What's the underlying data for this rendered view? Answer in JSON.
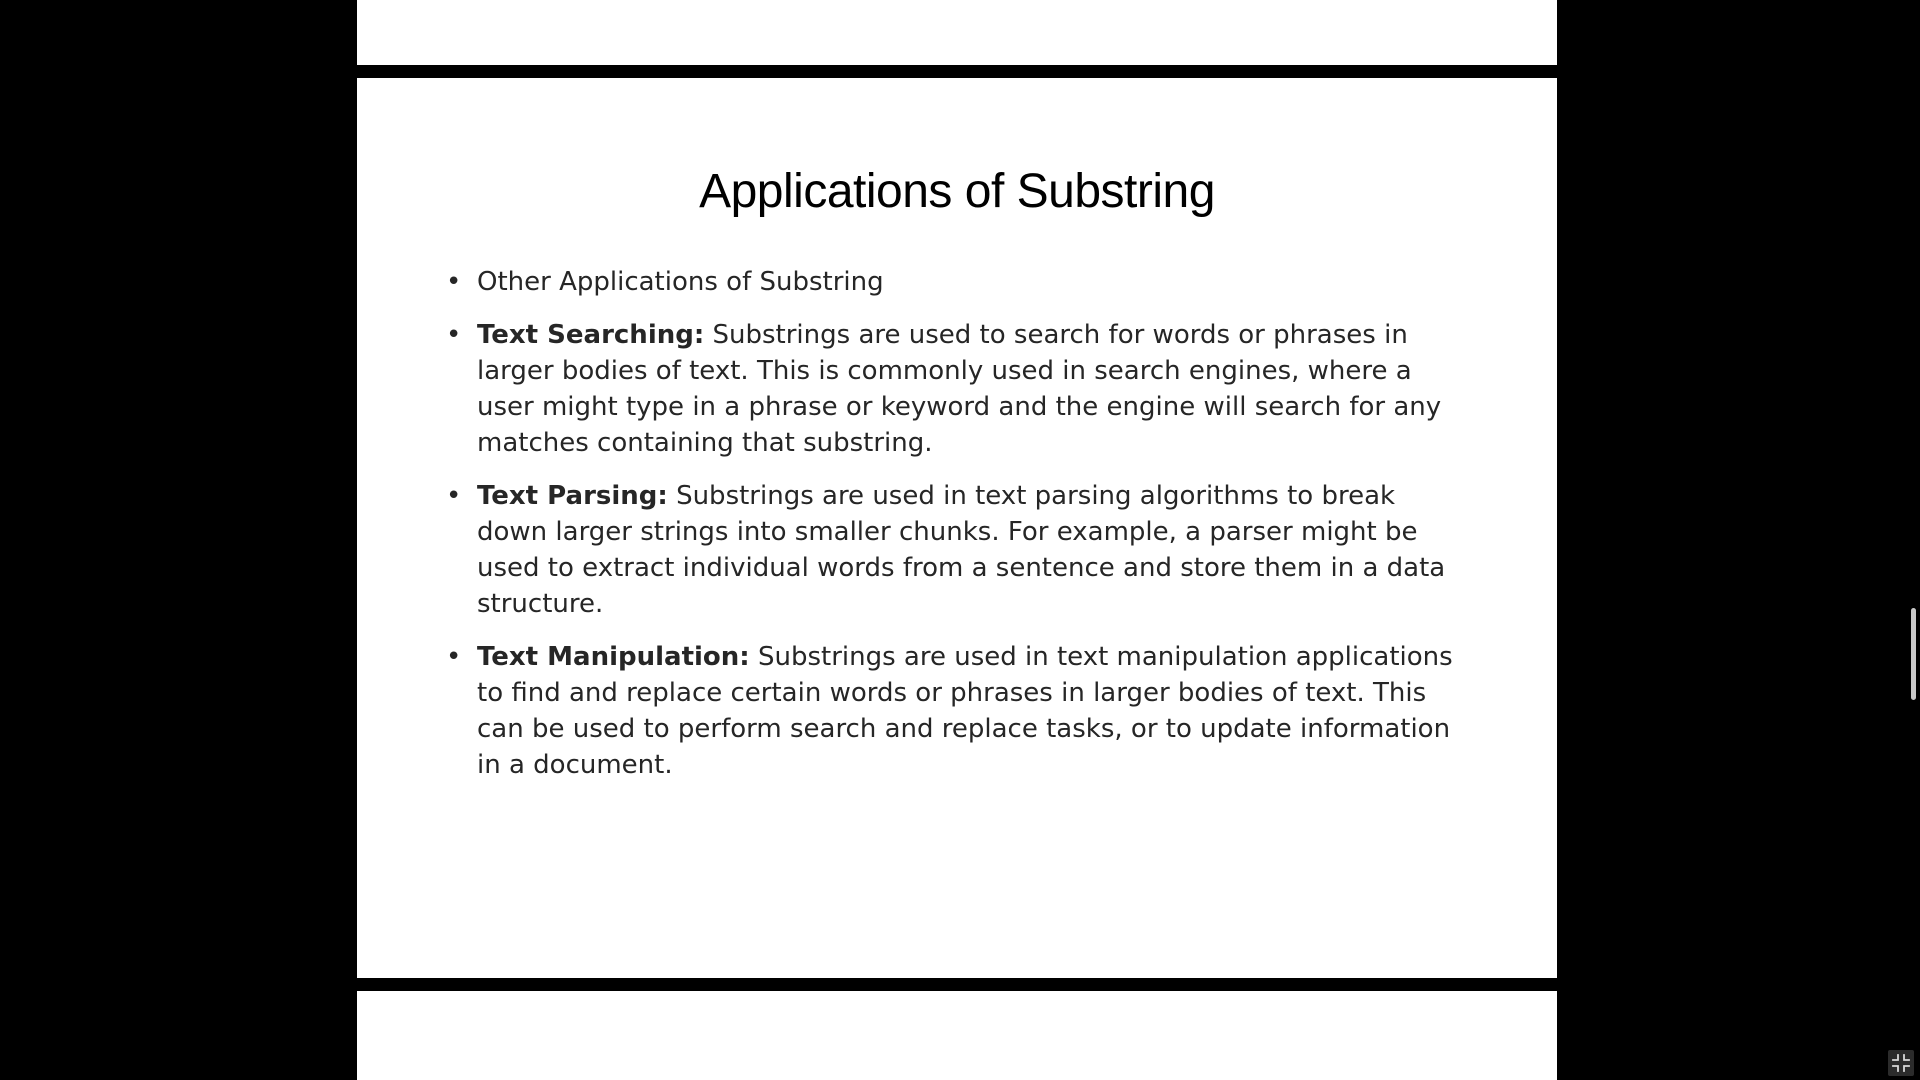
{
  "slide": {
    "title": "Applications of Substring",
    "bullets": [
      {
        "term": "",
        "text": "Other Applications of Substring"
      },
      {
        "term": "Text Searching:",
        "text": " Substrings are used to search for words or phrases in larger bodies of text. This is commonly used in search engines, where a user might type in a phrase or keyword and the engine will search for any matches containing that substring."
      },
      {
        "term": "Text Parsing:",
        "text": " Substrings are used in text parsing algorithms to break down larger strings into smaller chunks. For example, a parser might be used to extract individual words from a sentence and store them in a data structure."
      },
      {
        "term": "Text Manipulation:",
        "text": " Substrings are used in text manipulation applications to find and replace certain words or phrases in larger bodies of text. This can be used to perform search and replace tasks, or to update information in a document."
      }
    ]
  },
  "controls": {
    "exit_fullscreen_icon": "exit-fullscreen-icon"
  },
  "colors": {
    "background": "#000000",
    "slide": "#ffffff",
    "text": "#262626"
  }
}
